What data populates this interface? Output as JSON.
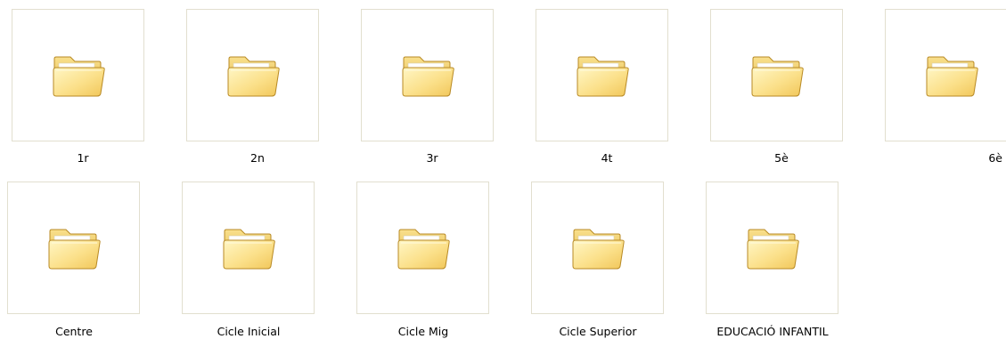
{
  "folders": [
    {
      "label": "1r"
    },
    {
      "label": "2n"
    },
    {
      "label": "3r"
    },
    {
      "label": "4t"
    },
    {
      "label": "5è"
    },
    {
      "label": "6è"
    },
    {
      "label": "Centre"
    },
    {
      "label": "Cicle Inicial"
    },
    {
      "label": "Cicle Mig"
    },
    {
      "label": "Cicle Superior"
    },
    {
      "label": "EDUCACIÓ INFANTIL"
    }
  ],
  "icons": {
    "folder": "folder-icon"
  },
  "colors": {
    "frame_border": "#e2dfcf",
    "folder_light": "#fff3b0",
    "folder_mid": "#f7d46a",
    "folder_dark": "#c9972b"
  }
}
